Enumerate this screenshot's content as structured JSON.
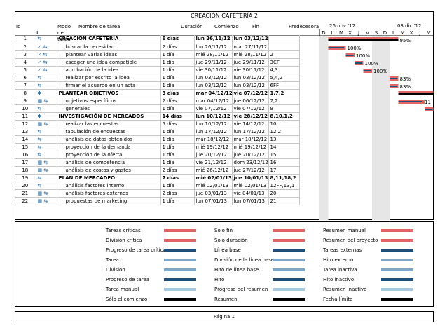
{
  "title": "CREACIÓN CAFETERÍA 2",
  "headers": {
    "id": "Id",
    "info_icon": "info-icon",
    "mode": "Modo de tarea",
    "name": "Nombre de tarea",
    "duration": "Duración",
    "start": "Comienzo",
    "end": "Fin",
    "pred": "Predecesoras",
    "week1": "26 nov '12",
    "week2": "03 dic '12",
    "days": [
      "D",
      "L",
      "M",
      "X",
      "J",
      "V",
      "S",
      "D",
      "L",
      "M",
      "X",
      "J",
      "V"
    ]
  },
  "tasks": [
    {
      "id": "1",
      "check": "",
      "icon": "task-icon",
      "name": "CREACIÓN CAFETERÍA",
      "dur": "6 días",
      "start": "lun 26/11/12",
      "end": "lun 03/12/12",
      "pred": "",
      "bold": true,
      "indent": 0
    },
    {
      "id": "2",
      "check": "✓",
      "icon": "task-icon",
      "name": "buscar la necesidad",
      "dur": "2 días",
      "start": "lun 26/11/12",
      "end": "mar 27/11/12",
      "pred": "",
      "bold": false,
      "indent": 1
    },
    {
      "id": "3",
      "check": "✓",
      "icon": "task-icon",
      "name": "plantear varias ideas",
      "dur": "1 día",
      "start": "mié 28/11/12",
      "end": "mié 28/11/12",
      "pred": "2",
      "bold": false,
      "indent": 1
    },
    {
      "id": "4",
      "check": "✓",
      "icon": "task-icon",
      "name": "escoger una idea compatible",
      "dur": "1 día",
      "start": "jue 29/11/12",
      "end": "jue 29/11/12",
      "pred": "3CF",
      "bold": false,
      "indent": 1
    },
    {
      "id": "5",
      "check": "✓",
      "icon": "task-icon",
      "name": "aprobación de la idea",
      "dur": "1 día",
      "start": "vie 30/11/12",
      "end": "vie 30/11/12",
      "pred": "4,3",
      "bold": false,
      "indent": 1
    },
    {
      "id": "6",
      "check": "",
      "icon": "task-icon",
      "name": "realizar por escrito la idea",
      "dur": "1 día",
      "start": "lun 03/12/12",
      "end": "lun 03/12/12",
      "pred": "5,4,2",
      "bold": false,
      "indent": 1
    },
    {
      "id": "7",
      "check": "",
      "icon": "task-icon",
      "name": "firmar el acuerdo en un acta",
      "dur": "1 día",
      "start": "lun 03/12/12",
      "end": "lun 03/12/12",
      "pred": "6FF",
      "bold": false,
      "indent": 1
    },
    {
      "id": "8",
      "check": "",
      "icon": "pin-icon",
      "name": "PLANTEAR OBJETIVOS",
      "dur": "3 días",
      "start": "mar 04/12/12",
      "end": "vie 07/12/12",
      "pred": "1,7,2",
      "bold": true,
      "indent": 0
    },
    {
      "id": "9",
      "check": "▦",
      "icon": "task-icon",
      "name": "objetivos específicos",
      "dur": "2 días",
      "start": "mar 04/12/12",
      "end": "jue 06/12/12",
      "pred": "7,2",
      "bold": false,
      "indent": 1
    },
    {
      "id": "10",
      "check": "",
      "icon": "task-icon",
      "name": "generales",
      "dur": "1 día",
      "start": "vie 07/12/12",
      "end": "vie 07/12/12",
      "pred": "9",
      "bold": false,
      "indent": 1
    },
    {
      "id": "11",
      "check": "",
      "icon": "pin-icon",
      "name": "INVESTIGACIÓN DE MERCADOS",
      "dur": "14 días",
      "start": "lun 10/12/12",
      "end": "vie 28/12/12",
      "pred": "8,10,1,2",
      "bold": true,
      "indent": 0
    },
    {
      "id": "12",
      "check": "▦",
      "icon": "task-icon",
      "name": "realizar las encuestas",
      "dur": "5 días",
      "start": "lun 10/12/12",
      "end": "vie 14/12/12",
      "pred": "10",
      "bold": false,
      "indent": 1
    },
    {
      "id": "13",
      "check": "",
      "icon": "task-icon",
      "name": "tabulación de encuestas",
      "dur": "1 día",
      "start": "lun 17/12/12",
      "end": "lun 17/12/12",
      "pred": "12,2",
      "bold": false,
      "indent": 1
    },
    {
      "id": "14",
      "check": "",
      "icon": "task-icon",
      "name": "análisis de datos obtenidos",
      "dur": "1 día",
      "start": "mar 18/12/12",
      "end": "mar 18/12/12",
      "pred": "13",
      "bold": false,
      "indent": 1
    },
    {
      "id": "15",
      "check": "",
      "icon": "task-icon",
      "name": "proyección de la demanda",
      "dur": "1 día",
      "start": "mié 19/12/12",
      "end": "mié 19/12/12",
      "pred": "14",
      "bold": false,
      "indent": 1
    },
    {
      "id": "16",
      "check": "",
      "icon": "task-icon",
      "name": "proyección de la oferta",
      "dur": "1 día",
      "start": "jue 20/12/12",
      "end": "jue 20/12/12",
      "pred": "15",
      "bold": false,
      "indent": 1
    },
    {
      "id": "17",
      "check": "▦",
      "icon": "task-icon",
      "name": "análisis de competencia",
      "dur": "1 día",
      "start": "vie 21/12/12",
      "end": "dom 23/12/12",
      "pred": "16",
      "bold": false,
      "indent": 1
    },
    {
      "id": "18",
      "check": "▦",
      "icon": "task-icon",
      "name": "análisis de costos y gastos",
      "dur": "2 días",
      "start": "mié 26/12/12",
      "end": "jue 27/12/12",
      "pred": "17",
      "bold": false,
      "indent": 1
    },
    {
      "id": "19",
      "check": "",
      "icon": "task-icon",
      "name": "PLAN DE MERCADEO",
      "dur": "7 días",
      "start": "mié 02/01/13",
      "end": "jue 10/01/13",
      "pred": "8,11,18,2",
      "bold": true,
      "indent": 0
    },
    {
      "id": "20",
      "check": "",
      "icon": "task-icon",
      "name": "análisis factores interno",
      "dur": "1 día",
      "start": "mié 02/01/13",
      "end": "mié 02/01/13",
      "pred": "12FF,13,1",
      "bold": false,
      "indent": 1
    },
    {
      "id": "21",
      "check": "▦",
      "icon": "task-icon",
      "name": "análisis factores externos",
      "dur": "2 días",
      "start": "jue 03/01/13",
      "end": "vie 04/01/13",
      "pred": "20",
      "bold": false,
      "indent": 1
    },
    {
      "id": "22",
      "check": "▦",
      "icon": "task-icon",
      "name": "propuestas de marketing",
      "dur": "1 día",
      "start": "lun 07/01/13",
      "end": "lun 07/01/13",
      "pred": "21",
      "bold": false,
      "indent": 1
    }
  ],
  "gantt_labels": [
    {
      "row": 0,
      "text": "95%"
    },
    {
      "row": 1,
      "text": "100%"
    },
    {
      "row": 2,
      "text": "100%"
    },
    {
      "row": 3,
      "text": "100%"
    },
    {
      "row": 4,
      "text": "100%"
    },
    {
      "row": 5,
      "text": "83%"
    },
    {
      "row": 6,
      "text": "83%"
    },
    {
      "row": 8,
      "text": "11"
    }
  ],
  "legend": {
    "col1": [
      "Tareas críticas",
      "División crítica",
      "Progreso de tarea crítica",
      "Tarea",
      "División",
      "Progreso de tarea",
      "Tarea manual",
      "Sólo el comienzo"
    ],
    "col2": [
      "Sólo fin",
      "Sólo duración",
      "Línea base",
      "División de la línea base",
      "Hito de línea base",
      "Hito",
      "Progreso del resumen",
      "Resumen"
    ],
    "col3": [
      "Resumen manual",
      "Resumen del proyecto",
      "Tareas externas",
      "Hito externo",
      "Tarea inactiva",
      "Hito inactivo",
      "Resumen inactivo",
      "Fecha límite"
    ]
  },
  "footer": "Página 1",
  "colors": {
    "critical": "#e06666",
    "task": "#7fa7c9",
    "progress": "#1f4e79",
    "summary": "#000000",
    "baseline": "#a0a0a0",
    "manual": "#a6c8e0",
    "deadline": "#2e7d32"
  }
}
